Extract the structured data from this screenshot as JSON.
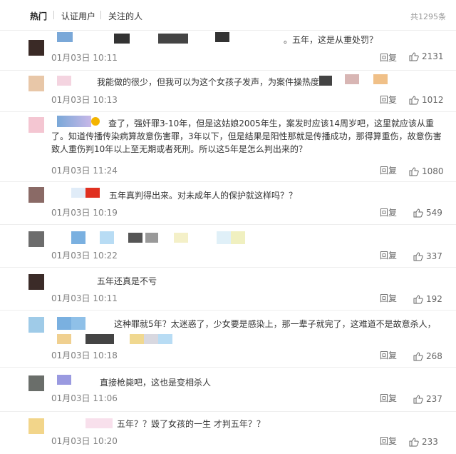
{
  "header": {
    "tabs": [
      "热门",
      "认证用户",
      "关注的人"
    ],
    "total": "共1295条"
  },
  "actions": {
    "reply_label": "回复",
    "like_icon": "thumbs-up-icon"
  },
  "comments": [
    {
      "text": "。五年，这是从重处罚？",
      "time": "01月03日 10:11",
      "likes": "2131",
      "avatar_color": "#3a2a26"
    },
    {
      "text": "我能做的很少，但我可以为这个女孩子发声，为案件操热度。",
      "time": "01月03日 10:13",
      "likes": "1012",
      "avatar_color": "#e8c7a8"
    },
    {
      "text": "查了，强奸罪3-10年，但是这姑娘2005年生，案发时应该14周岁吧，这里就应该从重了。知道传播传染病算故意伤害罪，3年以下，但是结果是阳性那就是传播成功，那得算重伤，故意伤害致人重伤判10年以上至无期或者死刑。所以这5年是怎么判出来的？",
      "time": "01月03日 11:24",
      "likes": "1080",
      "avatar_color": "#f4c6d2"
    },
    {
      "text": "五年真判得出来。对未成年人的保护就这样吗？？",
      "time": "01月03日 10:19",
      "likes": "549",
      "avatar_color": "#8a6a66"
    },
    {
      "text": "",
      "time": "01月03日 10:22",
      "likes": "337",
      "avatar_color": "#6c6c6c"
    },
    {
      "text": "五年还真是不亏",
      "time": "01月03日 10:11",
      "likes": "192",
      "avatar_color": "#3b2b28"
    },
    {
      "text": "这种罪就5年？太迷惑了，少女要是感染上，那一辈子就完了，这难道不是故意杀人，",
      "time": "01月03日 10:18",
      "likes": "268",
      "avatar_color": "#9fcbe8"
    },
    {
      "text": "直接枪毙吧，这也是变相杀人",
      "time": "01月03日 11:06",
      "likes": "237",
      "avatar_color": "#6a6e6a"
    },
    {
      "text": "五年？？毁了女孩的一生 才判五年？？",
      "time": "01月03日 10:20",
      "likes": "233",
      "avatar_color": "#f2d58a"
    }
  ]
}
